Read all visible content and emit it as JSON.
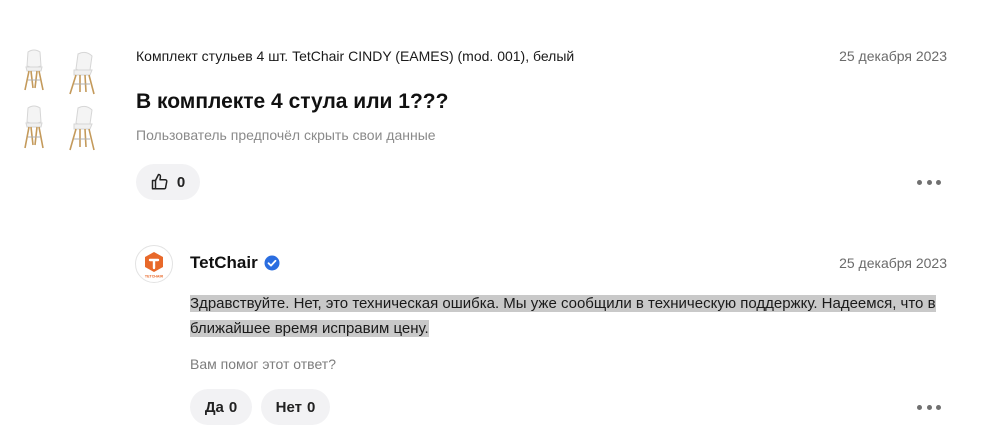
{
  "product": {
    "title": "Комплект стульев 4 шт. TetChair CINDY (EAMES) (mod. 001), белый",
    "thumbnail_icon": "chairs-thumbnail-icon"
  },
  "question": {
    "date": "25 декабря 2023",
    "text": "В комплекте 4 стула или 1???",
    "author": "Пользователь предпочёл скрыть свои данные",
    "likes": "0",
    "like_icon": "thumbs-up-icon",
    "more_icon": "more-dots-icon"
  },
  "answer": {
    "brand": "TetChair",
    "logo_text": "TETCHAIR",
    "verified_icon": "verified-check-icon",
    "date": "25 декабря 2023",
    "text": "Здравствуйте. Нет, это техническая ошибка. Мы уже сообщили в техническую поддержку. Надеемся, что в ближайшее время исправим цену.",
    "helpful_question": "Вам помог этот ответ?",
    "yes_label": "Да",
    "yes_count": "0",
    "no_label": "Нет",
    "no_count": "0",
    "more_icon": "more-dots-icon"
  },
  "colors": {
    "accent_blue": "#2a6de0",
    "logo_orange": "#e8692a",
    "pill_bg": "#f2f2f4",
    "highlight": "#c9c9c9"
  }
}
